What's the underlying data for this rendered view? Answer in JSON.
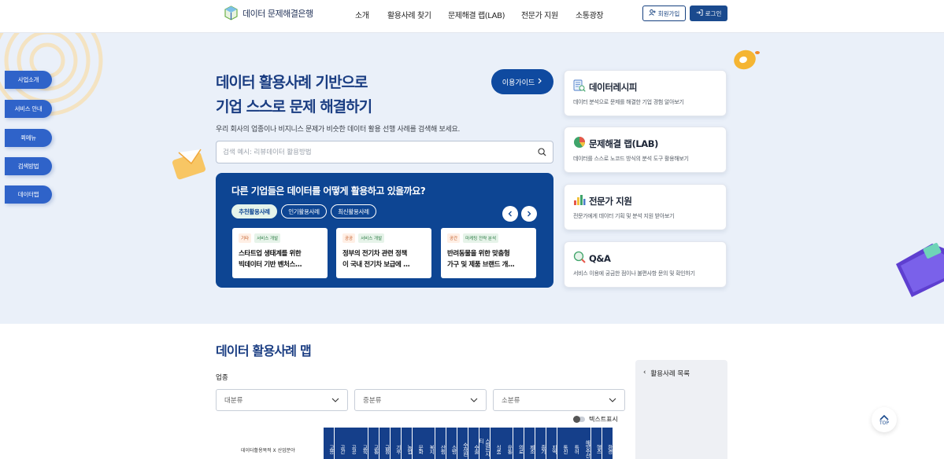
{
  "header": {
    "logo_text": "데이터 문제해결은행",
    "nav": [
      "소개",
      "활용사례 찾기",
      "문제해결 랩(LAB)",
      "전문가 지원",
      "소통광장"
    ],
    "join_label": "회원가입",
    "login_label": "로그인"
  },
  "side_menu": [
    "사업소개",
    "서비스 안내",
    "퀵메뉴",
    "검색방법",
    "데이터맵"
  ],
  "hero": {
    "title_line1": "데이터 활용사례 기반으로",
    "title_line2": "기업 스스로 문제 해결하기",
    "guide_button": "이용가이드",
    "subtitle": "우리 회사의 업종이나 비지니스 문제가 비슷한 데이터 활용 선행 사례를 검색해 보세요.",
    "search_placeholder": "검색 예시: 리뷰데이터 활용방법"
  },
  "panel": {
    "title": "다른 기업들은 데이터를 어떻게 활용하고 있을까요?",
    "tabs": [
      "추천활용사례",
      "인기활용사례",
      "최신활용사례"
    ],
    "cards": [
      {
        "tag1": "기타",
        "tag2": "서비스 개발",
        "title": "스타트업 생태계를 위한\n빅데이터 기반 벤처스..."
      },
      {
        "tag1": "공공",
        "tag2": "서비스 개발",
        "title": "정부의 전기차 관련 정책\n이 국내 전기차 보급에 ..."
      },
      {
        "tag1": "공간",
        "tag2": "마케팅 전략 분석",
        "title": "반려동물을 위한 맞춤형\n가구 및 제품 브랜드 개..."
      }
    ]
  },
  "features": [
    {
      "title": "데이터레시피",
      "desc": "데이터 분석으로 문제를 해결한 기업 경험 알아보기"
    },
    {
      "title": "문제해결 랩(LAB)",
      "desc": "데이터를 스스로 노코드 방식의 분석 도구 활용해보기"
    },
    {
      "title": "전문가 지원",
      "desc": "전문가에게 데이터 기획 및 분석 지원 받아보기"
    },
    {
      "title": "Q&A",
      "desc": "서비스 이용에 궁금한 점이나 불편사항 문의 및 확인하기"
    }
  ],
  "map_section": {
    "title": "데이터 활용사례 맵",
    "industry_label": "업종",
    "selects": [
      "대분류",
      "중분류",
      "소분류"
    ],
    "text_toggle": "텍스트표시",
    "matrix_label": "데이터활용목적 X 산업분야",
    "columns": [
      "고용",
      "공간",
      "공공",
      "교육",
      "교통",
      "금융",
      "기후",
      "농업",
      "문화",
      "복지",
      "산림",
      "소방",
      "수자원",
      "수출",
      "스마트시티",
      "식품",
      "유통",
      "의료",
      "제조",
      "중기",
      "지역",
      "통신",
      "특허",
      "해양수산",
      "헬스",
      "환경"
    ],
    "side_list_title": "활용사례 목록",
    "top_label": "TOP"
  },
  "colors": {
    "primary": "#0d4593",
    "side_button": "#2f63c9",
    "hero_bg": "#eaf0f9",
    "title": "#1a3d82"
  }
}
